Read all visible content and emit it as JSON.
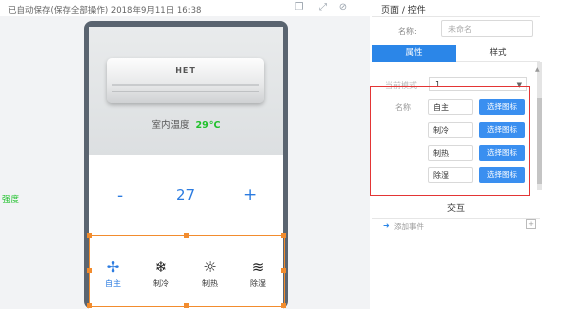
{
  "topbar": {
    "autosave": "已自动保存(保存全部操作) 2018年9月11日 16:38",
    "icons": [
      "copy-icon",
      "fullscreen-icon",
      "hide-icon"
    ]
  },
  "device": {
    "brand": "HET",
    "indoor_temp_label": "室内温度",
    "indoor_temp_value": "29°C",
    "speed_label": "强度",
    "minus": "-",
    "set_temp": "27",
    "plus": "+",
    "modes": [
      {
        "label": "自主",
        "icon": "fan-icon",
        "active": true
      },
      {
        "label": "制冷",
        "icon": "snowflake-icon",
        "active": false
      },
      {
        "label": "制热",
        "icon": "sun-icon",
        "active": false
      },
      {
        "label": "除湿",
        "icon": "dehumidify-icon",
        "active": false
      }
    ]
  },
  "panel": {
    "title": "页面 / 控件",
    "name_label": "名称:",
    "name_placeholder": "未命名",
    "tabs": [
      "属性",
      "样式"
    ],
    "mode_label": "当前模式",
    "mode_value": "1",
    "names_label": "名称",
    "icon_rows": [
      {
        "value": "自主",
        "button": "选择图标"
      },
      {
        "value": "制冷",
        "button": "选择图标"
      },
      {
        "value": "制热",
        "button": "选择图标"
      },
      {
        "value": "除湿",
        "button": "选择图标"
      }
    ],
    "interaction_title": "交互",
    "add_event": "添加事件",
    "add_symbol": "+"
  },
  "colors": {
    "accent": "#2b86e8",
    "selection": "#f28c2e",
    "highlight_box": "#e33535",
    "temp_green": "#1fc12b"
  }
}
